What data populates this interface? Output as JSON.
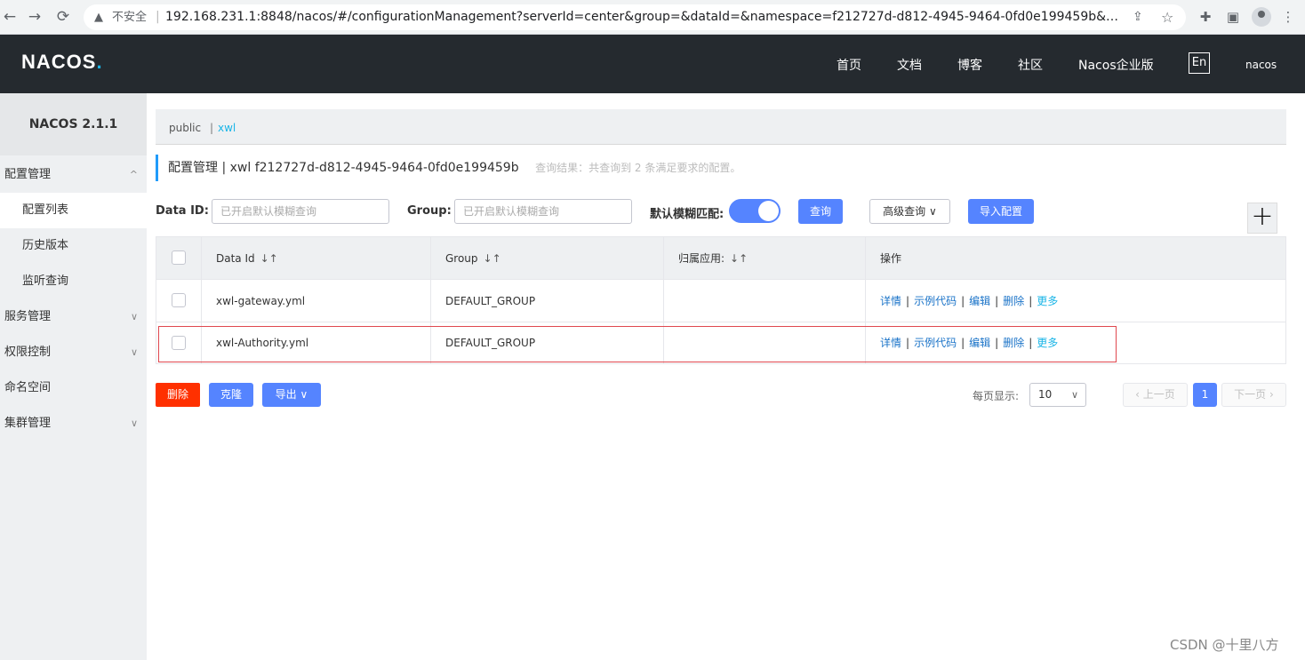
{
  "browser": {
    "back_icon": "←",
    "forward_icon": "→",
    "reload_icon": "⟳",
    "insecure_label": "不安全",
    "url_host": "192.168.231.1",
    "url_rest": ":8848/nacos/#/configurationManagement?serverId=center&group=&dataId=&namespace=f212727d-d812-4945-9464-0fd0e199459b&appNam..."
  },
  "header": {
    "logo_text": "NACOS",
    "logo_dot": ".",
    "nav": [
      "首页",
      "文档",
      "博客",
      "社区",
      "Nacos企业版"
    ],
    "lang": "En",
    "user": "nacos"
  },
  "sidebar": {
    "title": "NACOS 2.1.1",
    "items": [
      {
        "label": "配置管理",
        "caret": "^"
      },
      {
        "label": "配置列表"
      },
      {
        "label": "历史版本"
      },
      {
        "label": "监听查询"
      },
      {
        "label": "服务管理",
        "caret": "∨"
      },
      {
        "label": "权限控制",
        "caret": "∨"
      },
      {
        "label": "命名空间"
      },
      {
        "label": "集群管理",
        "caret": "∨"
      }
    ]
  },
  "breadcrumb": {
    "public": "public",
    "sep": "|",
    "current": "xwl"
  },
  "page": {
    "title": "配置管理 | xwl f212727d-d812-4945-9464-0fd0e199459b",
    "hint": "查询结果：共查询到 2 条满足要求的配置。"
  },
  "filters": {
    "dataid_label": "Data ID:",
    "dataid_placeholder": "已开启默认模糊查询",
    "group_label": "Group:",
    "group_placeholder": "已开启默认模糊查询",
    "fuzzy_label": "默认模糊匹配:",
    "query_btn": "查询",
    "advanced_btn": "高级查询",
    "import_btn": "导入配置",
    "add_btn": "+"
  },
  "table": {
    "headers": [
      "Data Id",
      "Group",
      "归属应用:",
      "操作"
    ],
    "sort_icon": "↓↑",
    "rows": [
      {
        "data_id": "xwl-gateway.yml",
        "group": "DEFAULT_GROUP",
        "app": ""
      },
      {
        "data_id": "xwl-Authority.yml",
        "group": "DEFAULT_GROUP",
        "app": ""
      }
    ],
    "ops": [
      "详情",
      "示例代码",
      "编辑",
      "删除",
      "更多"
    ],
    "op_sep": "|"
  },
  "footer": {
    "delete_btn": "删除",
    "clone_btn": "克隆",
    "export_btn": "导出",
    "pagesize_label": "每页显示:",
    "pagesize_value": "10",
    "prev": "上一页",
    "page": "1",
    "next": "下一页"
  },
  "watermark": "CSDN @十里八方",
  "colors": {
    "header_bg": "#252a2f",
    "primary": "#5584ff",
    "danger": "#ff3000",
    "link": "#1a73c8",
    "accent": "#1ab5e7"
  }
}
